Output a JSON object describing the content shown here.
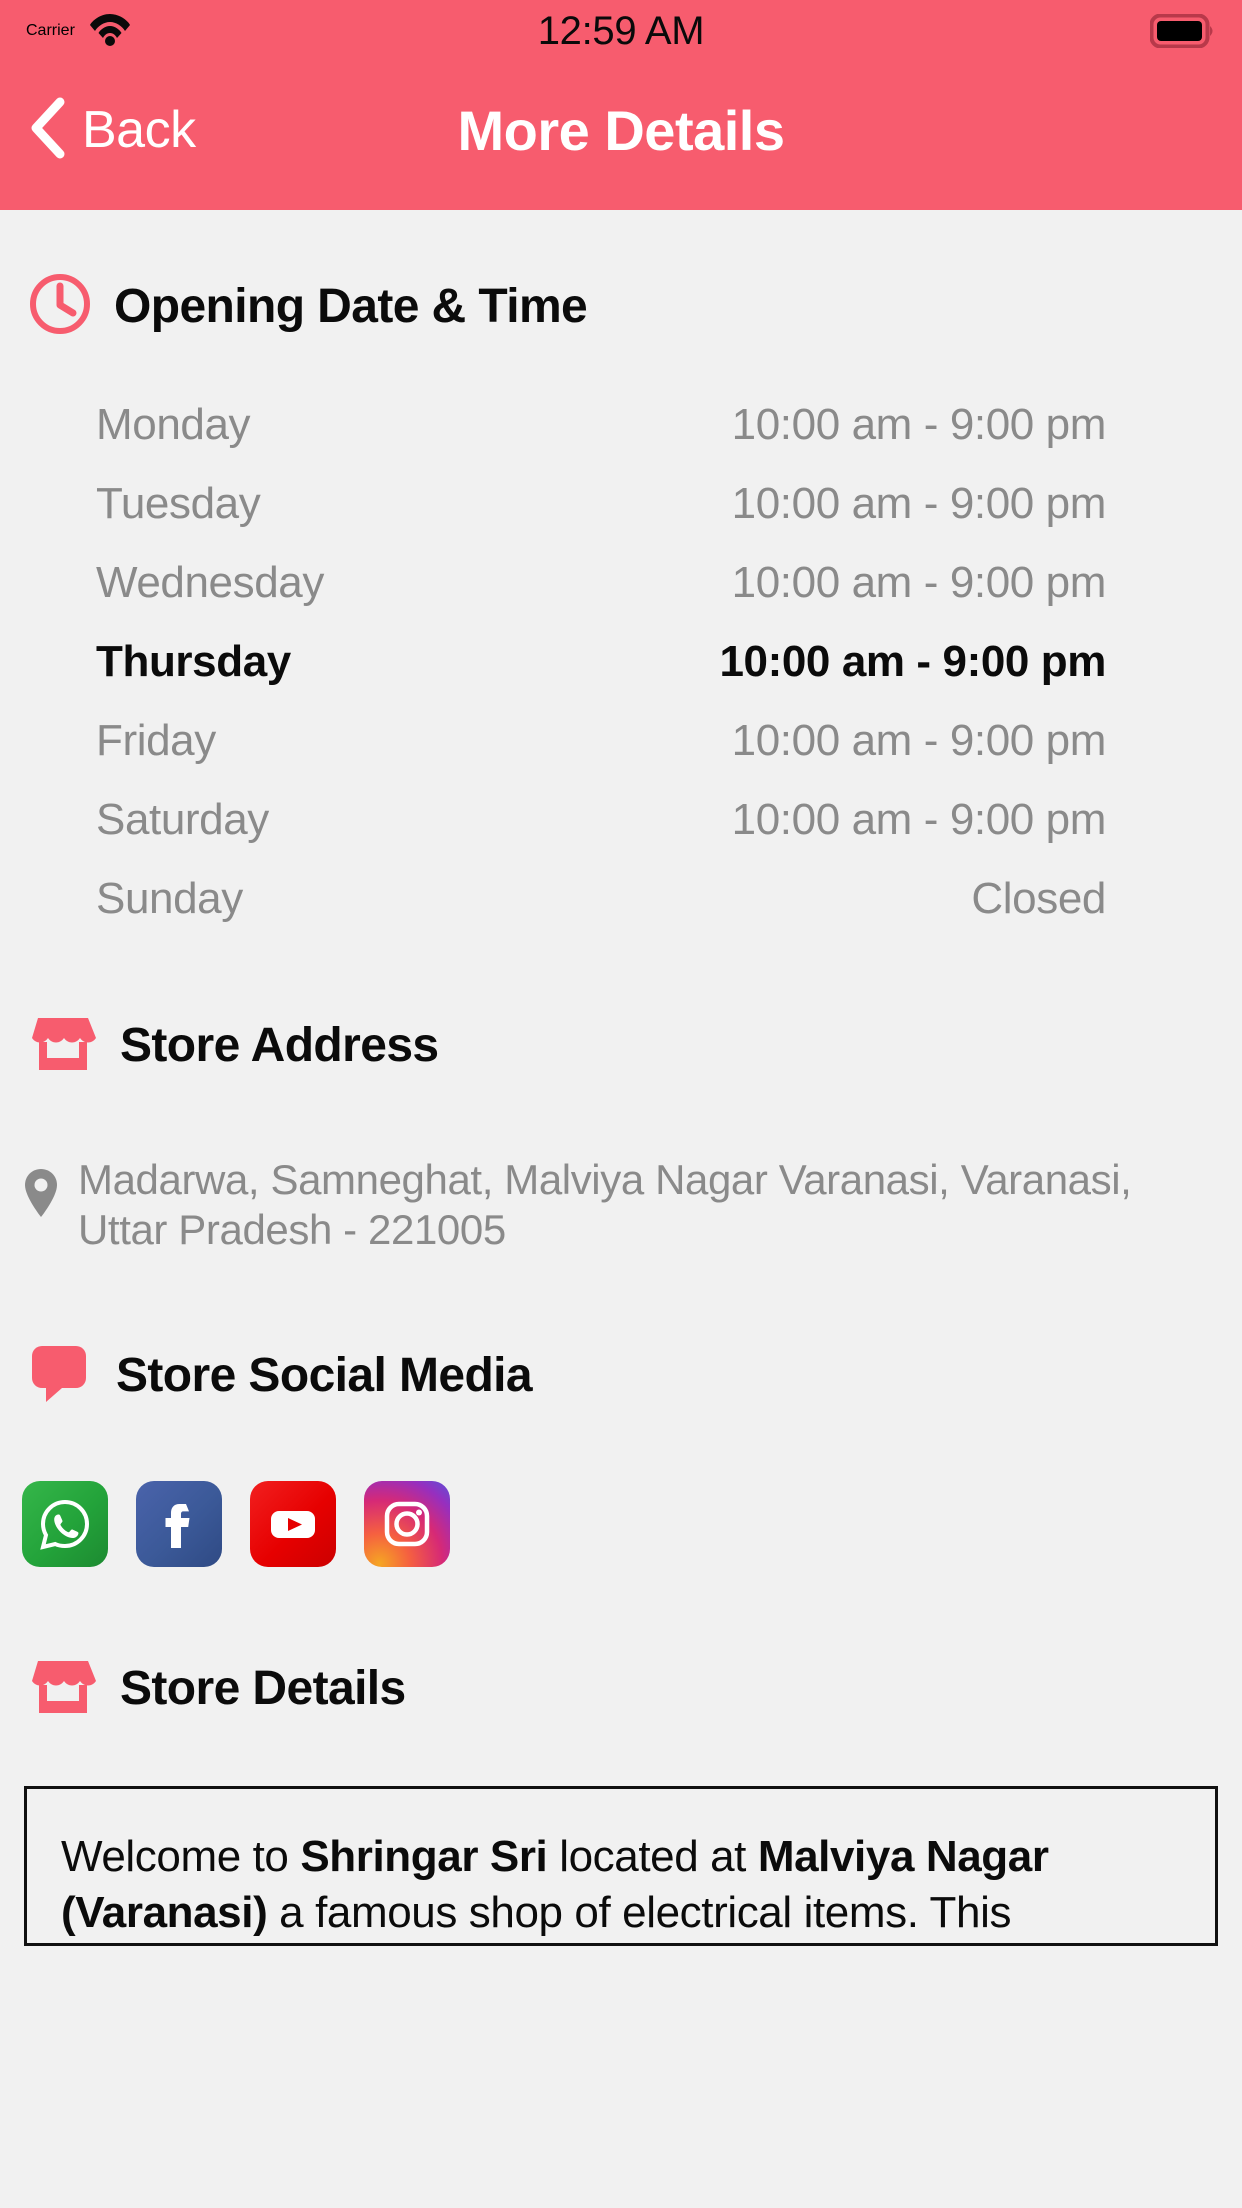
{
  "status_bar": {
    "carrier": "Carrier",
    "time": "12:59 AM",
    "wifi_icon": "wifi-icon",
    "battery_icon": "battery-full-icon"
  },
  "nav_bar": {
    "back_label": "Back",
    "back_icon": "chevron-left-icon",
    "title": "More Details"
  },
  "theme": {
    "accent": "#f75c6e",
    "background": "#f1f1f1",
    "muted_text": "#8a8a8a",
    "primary_text": "#0b0b0b"
  },
  "sections": {
    "hours": {
      "title": "Opening Date & Time",
      "icon": "clock-icon",
      "rows": [
        {
          "day": "Monday",
          "value": "10:00 am - 9:00 pm",
          "today": false
        },
        {
          "day": "Tuesday",
          "value": "10:00 am - 9:00 pm",
          "today": false
        },
        {
          "day": "Wednesday",
          "value": "10:00 am - 9:00 pm",
          "today": false
        },
        {
          "day": "Thursday",
          "value": "10:00 am - 9:00 pm",
          "today": true
        },
        {
          "day": "Friday",
          "value": "10:00 am - 9:00 pm",
          "today": false
        },
        {
          "day": "Saturday",
          "value": "10:00 am - 9:00 pm",
          "today": false
        },
        {
          "day": "Sunday",
          "value": "Closed",
          "today": false
        }
      ]
    },
    "address": {
      "title": "Store Address",
      "icon": "storefront-icon",
      "pin_icon": "map-pin-icon",
      "text": "Madarwa, Samneghat, Malviya Nagar Varanasi, Varanasi, Uttar Pradesh - 221005"
    },
    "social": {
      "title": "Store Social Media",
      "icon": "speech-bubble-icon",
      "links": [
        {
          "name": "whatsapp",
          "label": "WhatsApp"
        },
        {
          "name": "facebook",
          "label": "Facebook"
        },
        {
          "name": "youtube",
          "label": "YouTube"
        },
        {
          "name": "instagram",
          "label": "Instagram"
        }
      ]
    },
    "details": {
      "title": "Store Details",
      "icon": "storefront-icon",
      "body_parts": [
        {
          "text": "Welcome to ",
          "bold": false
        },
        {
          "text": "Shringar Sri",
          "bold": true
        },
        {
          "text": " located at ",
          "bold": false
        },
        {
          "text": "Malviya Nagar (Varanasi)",
          "bold": true
        },
        {
          "text": " a famous shop of electrical items. This",
          "bold": false
        }
      ]
    }
  }
}
